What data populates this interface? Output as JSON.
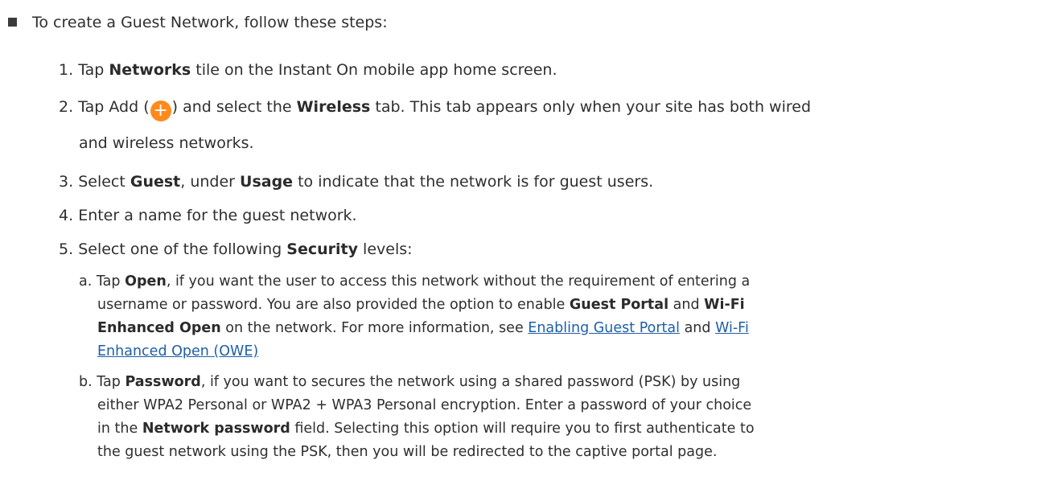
{
  "intro": "To create a Guest Network, follow these steps:",
  "steps": {
    "s1": {
      "num": "1.",
      "pre": "Tap ",
      "b1": "Networks",
      "post": " tile on the Instant On mobile app home screen."
    },
    "s2": {
      "num": "2.",
      "pre": "Tap Add (",
      "mid": ") and select the ",
      "b1": "Wireless",
      "post": " tab. This tab appears only when your site has both wired",
      "line2": "and wireless networks."
    },
    "s3": {
      "num": "3.",
      "pre": "Select ",
      "b1": "Guest",
      "mid": ", under ",
      "b2": "Usage",
      "post": " to indicate that the network is for guest users."
    },
    "s4": {
      "num": "4.",
      "text": "Enter a name for the guest network."
    },
    "s5": {
      "num": "5.",
      "pre": "Select one of the following ",
      "b1": "Security",
      "post": " levels:"
    }
  },
  "sub": {
    "a": {
      "letter": "a.",
      "l1_pre": "Tap ",
      "l1_b": "Open",
      "l1_post": ", if you want the user to access this network without the requirement of entering a",
      "l2_pre": "username or password. You are also provided the option to enable ",
      "l2_b1": "Guest Portal",
      "l2_mid": " and ",
      "l2_b2": "Wi-Fi",
      "l3_b": "Enhanced Open",
      "l3_mid": " on the network. For more information, see ",
      "l3_link1": "Enabling Guest Portal",
      "l3_and": " and ",
      "l3_link2": "Wi-Fi",
      "l4_link": "Enhanced Open (OWE)"
    },
    "b": {
      "letter": "b.",
      "l1_pre": "Tap ",
      "l1_b": "Password",
      "l1_post": ", if you want to secures the network using a shared password (PSK) by using",
      "l2": "either WPA2 Personal or WPA2 + WPA3 Personal encryption. Enter a password of your choice",
      "l3_pre": "in the ",
      "l3_b": "Network password",
      "l3_post": " field. Selecting this option will require you to first authenticate to",
      "l4": "the guest network using the PSK, then you will be redirected to the captive portal page."
    }
  },
  "icons": {
    "add_icon": "plus-icon",
    "add_color": "#ff8a1c",
    "link_color": "#1f5fa8"
  }
}
